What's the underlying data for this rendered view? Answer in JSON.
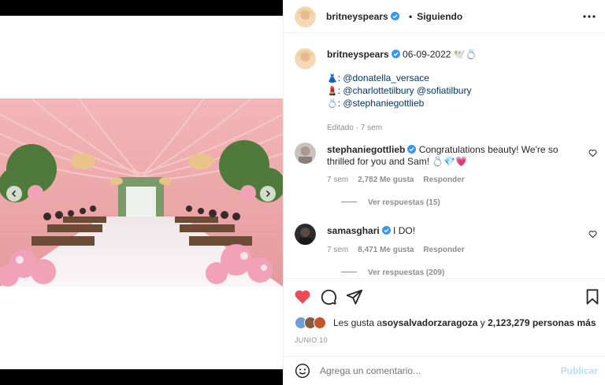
{
  "post": {
    "author": "britneyspears",
    "follow_label": "Siguiendo",
    "caption": {
      "author": "britneyspears",
      "date_text": "06-09-2022 🕊️💍",
      "lines": [
        {
          "emoji": "👗",
          "text": ": @donatella_versace"
        },
        {
          "emoji": "💄",
          "text": ": @charlottetilbury @sofiatilbury"
        },
        {
          "emoji": "💍",
          "text": ": @stephaniegottlieb"
        }
      ],
      "meta": "Editado · 7 sem"
    },
    "comments": [
      {
        "user": "stephaniegottlieb",
        "text": "Congratulations beauty! We're so thrilled for you and Sam! 💍💎💗",
        "time": "7 sem",
        "likes": "2,782 Me gusta",
        "reply": "Responder",
        "view_replies": "Ver respuestas (15)"
      },
      {
        "user": "samasghari",
        "text": "I DO!",
        "time": "7 sem",
        "likes": "8,471 Me gusta",
        "reply": "Responder",
        "view_replies": "Ver respuestas (209)"
      }
    ],
    "likes_text_prefix": "Les gusta a ",
    "likes_user": "soysalvadorzaragoza",
    "likes_text_mid": " y ",
    "likes_count": "2,123,279 personas más",
    "date": "JUNIO 10",
    "add_comment_placeholder": "Agrega un comentario...",
    "publish_label": "Publicar"
  },
  "colors": {
    "like_red": "#ed4956",
    "verified_blue": "#3897f0",
    "mention_blue": "#00376b",
    "publish_disabled": "#b2dffc"
  },
  "icons": [
    "heart-icon",
    "comment-icon",
    "share-icon",
    "save-icon",
    "more-icon",
    "smile-icon",
    "verified-icon",
    "chevron-left-icon",
    "chevron-right-icon"
  ]
}
